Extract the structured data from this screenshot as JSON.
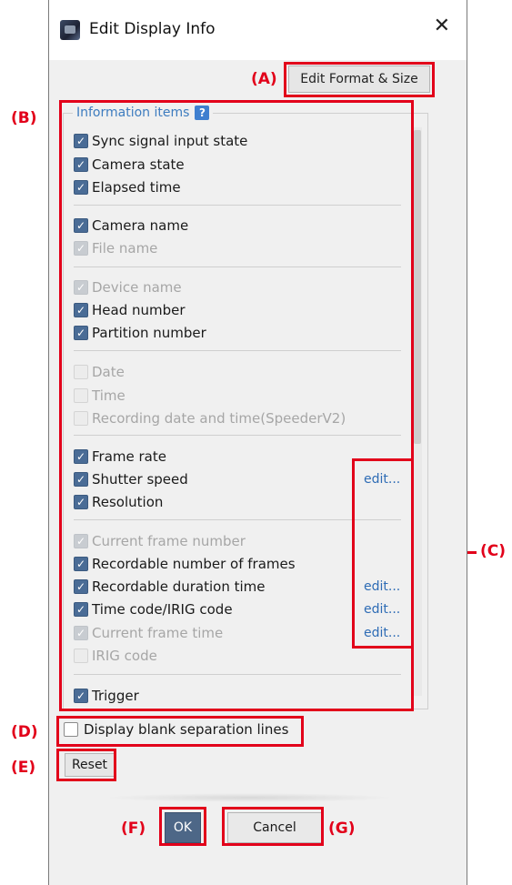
{
  "dialog": {
    "title": "Edit Display Info",
    "close_icon": "close-icon",
    "app_icon": "camera-app-icon"
  },
  "annotations": {
    "A": "(A)",
    "B": "(B)",
    "C": "(C)",
    "D": "(D)",
    "E": "(E)",
    "F": "(F)",
    "G": "(G)"
  },
  "buttons": {
    "edit_format": "Edit Format & Size",
    "reset": "Reset",
    "ok": "OK",
    "cancel": "Cancel"
  },
  "group": {
    "legend": "Information items",
    "help_icon": "?"
  },
  "items": [
    {
      "label": "Sync signal input state",
      "state": "on"
    },
    {
      "label": "Camera state",
      "state": "on"
    },
    {
      "label": "Elapsed time",
      "state": "on"
    },
    {
      "label": "Camera name",
      "state": "on"
    },
    {
      "label": "File name",
      "state": "on-disabled"
    },
    {
      "label": "Device name",
      "state": "on-disabled"
    },
    {
      "label": "Head number",
      "state": "on"
    },
    {
      "label": "Partition number",
      "state": "on"
    },
    {
      "label": "Date",
      "state": "off-disabled"
    },
    {
      "label": "Time",
      "state": "off-disabled"
    },
    {
      "label": "Recording date and time(SpeederV2)",
      "state": "off-disabled"
    },
    {
      "label": "Frame rate",
      "state": "on"
    },
    {
      "label": "Shutter speed",
      "state": "on"
    },
    {
      "label": "Resolution",
      "state": "on"
    },
    {
      "label": "Current frame number",
      "state": "on-disabled"
    },
    {
      "label": "Recordable number of frames",
      "state": "on"
    },
    {
      "label": "Recordable duration time",
      "state": "on"
    },
    {
      "label": "Time code/IRIG code",
      "state": "on"
    },
    {
      "label": "Current frame time",
      "state": "on-disabled"
    },
    {
      "label": "IRIG code",
      "state": "off-disabled"
    },
    {
      "label": "Trigger",
      "state": "on"
    }
  ],
  "edit_links": [
    "edit...",
    "edit...",
    "edit...",
    "edit..."
  ],
  "blank_lines": {
    "label": "Display blank separation lines",
    "checked": false
  }
}
